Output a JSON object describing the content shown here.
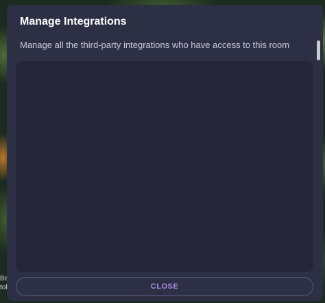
{
  "background": {
    "edge_text_lines": [
      "Ba",
      "tol"
    ]
  },
  "dialog": {
    "title": "Manage Integrations",
    "subtitle": "Manage all the third-party integrations who have access to this room",
    "close_label": "CLOSE"
  },
  "colors": {
    "dialog_background": "#2d2f45",
    "panel_background": "#242638",
    "accent": "#a98ae6",
    "button_border": "#5a5a86"
  }
}
